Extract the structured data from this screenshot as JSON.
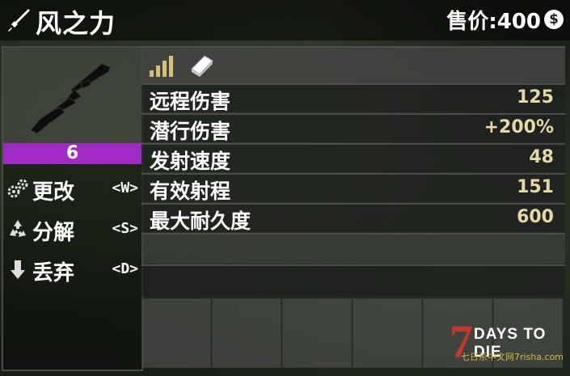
{
  "header": {
    "title": "风之力",
    "price": "售价:400",
    "coin_symbol": "$",
    "title_icon": "crossed-weapons-icon"
  },
  "weapon": {
    "icon": "shotgun-icon",
    "quality": "6",
    "quality_color": "#a02bc4"
  },
  "actions": [
    {
      "icon": "gears-icon",
      "label": "更改",
      "key": "<W>"
    },
    {
      "icon": "recycle-icon",
      "label": "分解",
      "key": "<S>"
    },
    {
      "icon": "drop-arrow-icon",
      "label": "丢弃",
      "key": "<D>"
    }
  ],
  "stats_header": {
    "icons": [
      "signal-bars-icon",
      "book-icon"
    ]
  },
  "stats": [
    {
      "label": "远程伤害",
      "value": "125"
    },
    {
      "label": "潜行伤害",
      "value": "+200%"
    },
    {
      "label": "发射速度",
      "value": "48"
    },
    {
      "label": "有效射程",
      "value": "151"
    },
    {
      "label": "最大耐久度",
      "value": "600"
    }
  ],
  "watermark": {
    "logo": "7",
    "title": "DAYS TO DIE",
    "subtitle": "七日杀中文网7risha.com"
  },
  "colors": {
    "stat_value": "#e6d7a6",
    "accent_purple": "#a02bc4"
  }
}
